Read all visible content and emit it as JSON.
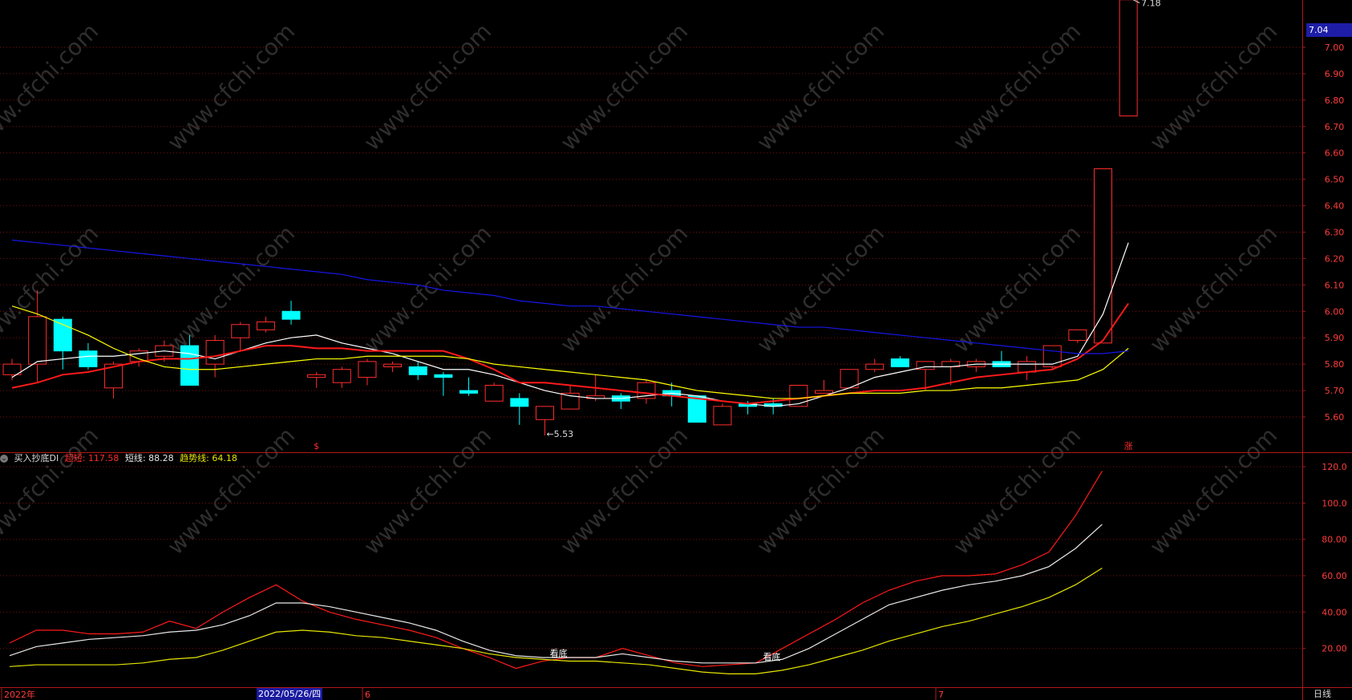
{
  "chart_data": [
    {
      "type": "candlestick",
      "price_axis": {
        "ticks": [
          "7.00",
          "6.90",
          "6.80",
          "6.70",
          "6.60",
          "6.50",
          "6.40",
          "6.30",
          "6.20",
          "6.10",
          "6.00",
          "5.90",
          "5.80",
          "5.70",
          "5.60"
        ],
        "ylim": [
          5.46,
          7.18
        ]
      },
      "current_price_badge": "7.04",
      "high_marker": "7.18",
      "low_marker": "5.53",
      "candles": [
        {
          "o": 5.76,
          "h": 5.82,
          "l": 5.74,
          "c": 5.8
        },
        {
          "o": 5.8,
          "h": 6.08,
          "l": 5.73,
          "c": 5.98
        },
        {
          "o": 5.97,
          "h": 5.98,
          "l": 5.78,
          "c": 5.85
        },
        {
          "o": 5.85,
          "h": 5.88,
          "l": 5.78,
          "c": 5.79
        },
        {
          "o": 5.71,
          "h": 5.81,
          "l": 5.67,
          "c": 5.8
        },
        {
          "o": 5.81,
          "h": 5.86,
          "l": 5.79,
          "c": 5.85
        },
        {
          "o": 5.83,
          "h": 5.89,
          "l": 5.81,
          "c": 5.87
        },
        {
          "o": 5.87,
          "h": 5.91,
          "l": 5.72,
          "c": 5.72
        },
        {
          "o": 5.8,
          "h": 5.91,
          "l": 5.75,
          "c": 5.89
        },
        {
          "o": 5.9,
          "h": 5.96,
          "l": 5.85,
          "c": 5.95
        },
        {
          "o": 5.93,
          "h": 5.98,
          "l": 5.92,
          "c": 5.96
        },
        {
          "o": 6.0,
          "h": 6.04,
          "l": 5.95,
          "c": 5.97
        },
        {
          "o": 5.75,
          "h": 5.77,
          "l": 5.71,
          "c": 5.76
        },
        {
          "o": 5.73,
          "h": 5.79,
          "l": 5.71,
          "c": 5.78
        },
        {
          "o": 5.75,
          "h": 5.82,
          "l": 5.72,
          "c": 5.81
        },
        {
          "o": 5.79,
          "h": 5.81,
          "l": 5.77,
          "c": 5.8
        },
        {
          "o": 5.79,
          "h": 5.81,
          "l": 5.74,
          "c": 5.76
        },
        {
          "o": 5.76,
          "h": 5.77,
          "l": 5.68,
          "c": 5.75
        },
        {
          "o": 5.7,
          "h": 5.75,
          "l": 5.68,
          "c": 5.69
        },
        {
          "o": 5.66,
          "h": 5.73,
          "l": 5.66,
          "c": 5.72
        },
        {
          "o": 5.67,
          "h": 5.69,
          "l": 5.57,
          "c": 5.64
        },
        {
          "o": 5.59,
          "h": 5.64,
          "l": 5.53,
          "c": 5.64
        },
        {
          "o": 5.63,
          "h": 5.72,
          "l": 5.63,
          "c": 5.69
        },
        {
          "o": 5.67,
          "h": 5.76,
          "l": 5.66,
          "c": 5.68
        },
        {
          "o": 5.68,
          "h": 5.69,
          "l": 5.63,
          "c": 5.66
        },
        {
          "o": 5.67,
          "h": 5.74,
          "l": 5.65,
          "c": 5.73
        },
        {
          "o": 5.7,
          "h": 5.73,
          "l": 5.64,
          "c": 5.68
        },
        {
          "o": 5.68,
          "h": 5.68,
          "l": 5.58,
          "c": 5.58
        },
        {
          "o": 5.57,
          "h": 5.65,
          "l": 5.57,
          "c": 5.64
        },
        {
          "o": 5.65,
          "h": 5.66,
          "l": 5.61,
          "c": 5.64
        },
        {
          "o": 5.65,
          "h": 5.67,
          "l": 5.61,
          "c": 5.64
        },
        {
          "o": 5.64,
          "h": 5.72,
          "l": 5.64,
          "c": 5.72
        },
        {
          "o": 5.69,
          "h": 5.74,
          "l": 5.69,
          "c": 5.7
        },
        {
          "o": 5.71,
          "h": 5.78,
          "l": 5.71,
          "c": 5.78
        },
        {
          "o": 5.78,
          "h": 5.82,
          "l": 5.77,
          "c": 5.8
        },
        {
          "o": 5.82,
          "h": 5.83,
          "l": 5.79,
          "c": 5.79
        },
        {
          "o": 5.78,
          "h": 5.81,
          "l": 5.7,
          "c": 5.81
        },
        {
          "o": 5.79,
          "h": 5.82,
          "l": 5.72,
          "c": 5.81
        },
        {
          "o": 5.79,
          "h": 5.82,
          "l": 5.77,
          "c": 5.81
        },
        {
          "o": 5.81,
          "h": 5.85,
          "l": 5.79,
          "c": 5.79
        },
        {
          "o": 5.77,
          "h": 5.83,
          "l": 5.74,
          "c": 5.81
        },
        {
          "o": 5.79,
          "h": 5.87,
          "l": 5.78,
          "c": 5.87
        },
        {
          "o": 5.89,
          "h": 5.93,
          "l": 5.88,
          "c": 5.93
        },
        {
          "o": 5.88,
          "h": 6.54,
          "l": 5.88,
          "c": 6.54
        },
        {
          "o": 6.74,
          "h": 7.18,
          "l": 6.74,
          "c": 7.18
        }
      ],
      "ma_lines": [
        {
          "color": "#ffffff",
          "values": [
            5.75,
            5.81,
            5.82,
            5.83,
            5.83,
            5.84,
            5.85,
            5.84,
            5.82,
            5.85,
            5.88,
            5.9,
            5.91,
            5.88,
            5.86,
            5.84,
            5.81,
            5.78,
            5.78,
            5.76,
            5.73,
            5.7,
            5.68,
            5.67,
            5.67,
            5.68,
            5.69,
            5.68,
            5.66,
            5.65,
            5.64,
            5.65,
            5.68,
            5.71,
            5.75,
            5.77,
            5.79,
            5.79,
            5.8,
            5.8,
            5.8,
            5.8,
            5.83,
            5.99,
            6.26
          ]
        },
        {
          "color": "#ff1a1a",
          "values": [
            5.71,
            5.73,
            5.76,
            5.77,
            5.79,
            5.81,
            5.82,
            5.82,
            5.83,
            5.85,
            5.87,
            5.87,
            5.86,
            5.86,
            5.85,
            5.85,
            5.85,
            5.85,
            5.82,
            5.78,
            5.73,
            5.73,
            5.72,
            5.71,
            5.7,
            5.69,
            5.68,
            5.67,
            5.66,
            5.65,
            5.66,
            5.67,
            5.68,
            5.69,
            5.7,
            5.7,
            5.71,
            5.73,
            5.75,
            5.76,
            5.77,
            5.78,
            5.82,
            5.89,
            6.03
          ]
        },
        {
          "color": "#ffff00",
          "values": [
            6.02,
            5.99,
            5.95,
            5.91,
            5.86,
            5.82,
            5.79,
            5.78,
            5.78,
            5.79,
            5.8,
            5.81,
            5.82,
            5.82,
            5.83,
            5.83,
            5.83,
            5.83,
            5.82,
            5.8,
            5.79,
            5.78,
            5.77,
            5.76,
            5.75,
            5.74,
            5.72,
            5.7,
            5.69,
            5.68,
            5.67,
            5.67,
            5.68,
            5.69,
            5.69,
            5.69,
            5.7,
            5.7,
            5.71,
            5.71,
            5.72,
            5.73,
            5.74,
            5.78,
            5.86
          ]
        },
        {
          "color": "#1616e8",
          "values": [
            6.27,
            6.26,
            6.25,
            6.24,
            6.23,
            6.22,
            6.21,
            6.2,
            6.19,
            6.18,
            6.17,
            6.16,
            6.15,
            6.14,
            6.12,
            6.11,
            6.1,
            6.08,
            6.07,
            6.06,
            6.04,
            6.03,
            6.02,
            6.02,
            6.01,
            6.0,
            5.99,
            5.98,
            5.97,
            5.96,
            5.95,
            5.94,
            5.94,
            5.93,
            5.92,
            5.91,
            5.9,
            5.89,
            5.88,
            5.87,
            5.86,
            5.85,
            5.84,
            5.84,
            5.85
          ]
        }
      ],
      "signal_marks": [
        {
          "index": 12,
          "text": "$"
        },
        {
          "index": 44,
          "text": "涨"
        }
      ]
    },
    {
      "type": "line",
      "indicator_name": "买入抄底DI",
      "y_axis": {
        "ticks": [
          "120.0",
          "100.0",
          "80.00",
          "60.00",
          "40.00",
          "20.00"
        ],
        "ylim": [
          0,
          125
        ]
      },
      "series": [
        {
          "name": "超短",
          "value_label": "117.58",
          "color": "#ff1a1a",
          "values": [
            23,
            30,
            30,
            28,
            28,
            29,
            35,
            31,
            40,
            48,
            55,
            46,
            40,
            36,
            33,
            30,
            26,
            20,
            15,
            9,
            13,
            15,
            15,
            20,
            16,
            12,
            10,
            11,
            12,
            20,
            28,
            36,
            45,
            52,
            57,
            60,
            60,
            61,
            66,
            73,
            93,
            117.58
          ]
        },
        {
          "name": "短线",
          "value_label": "88.28",
          "color": "#e8e8e8",
          "values": [
            16,
            21,
            23,
            25,
            26,
            27,
            29,
            30,
            33,
            38,
            45,
            45,
            43,
            40,
            37,
            34,
            30,
            24,
            19,
            16,
            15,
            15,
            15,
            17,
            15,
            13,
            12,
            12,
            12,
            14,
            20,
            28,
            36,
            44,
            48,
            52,
            55,
            57,
            60,
            65,
            75,
            88.28
          ]
        },
        {
          "name": "趋势线",
          "value_label": "64.18",
          "color": "#e6e600",
          "values": [
            10,
            11,
            11,
            11,
            11,
            12,
            14,
            15,
            19,
            24,
            29,
            30,
            29,
            27,
            26,
            24,
            22,
            20,
            17,
            15,
            14,
            13,
            13,
            12,
            11,
            9,
            7,
            6,
            6,
            8,
            11,
            15,
            19,
            24,
            28,
            32,
            35,
            39,
            43,
            48,
            55,
            64.18
          ]
        }
      ],
      "annotations": [
        {
          "text": "看底",
          "index": 20,
          "value": 14
        },
        {
          "text": "看底",
          "index": 28,
          "value": 12
        }
      ]
    }
  ],
  "x_axis_labels": [
    "2022年",
    "2022/05/26/四",
    "6",
    "7"
  ],
  "period_label": "日线",
  "watermark": "www.cfchi.com"
}
